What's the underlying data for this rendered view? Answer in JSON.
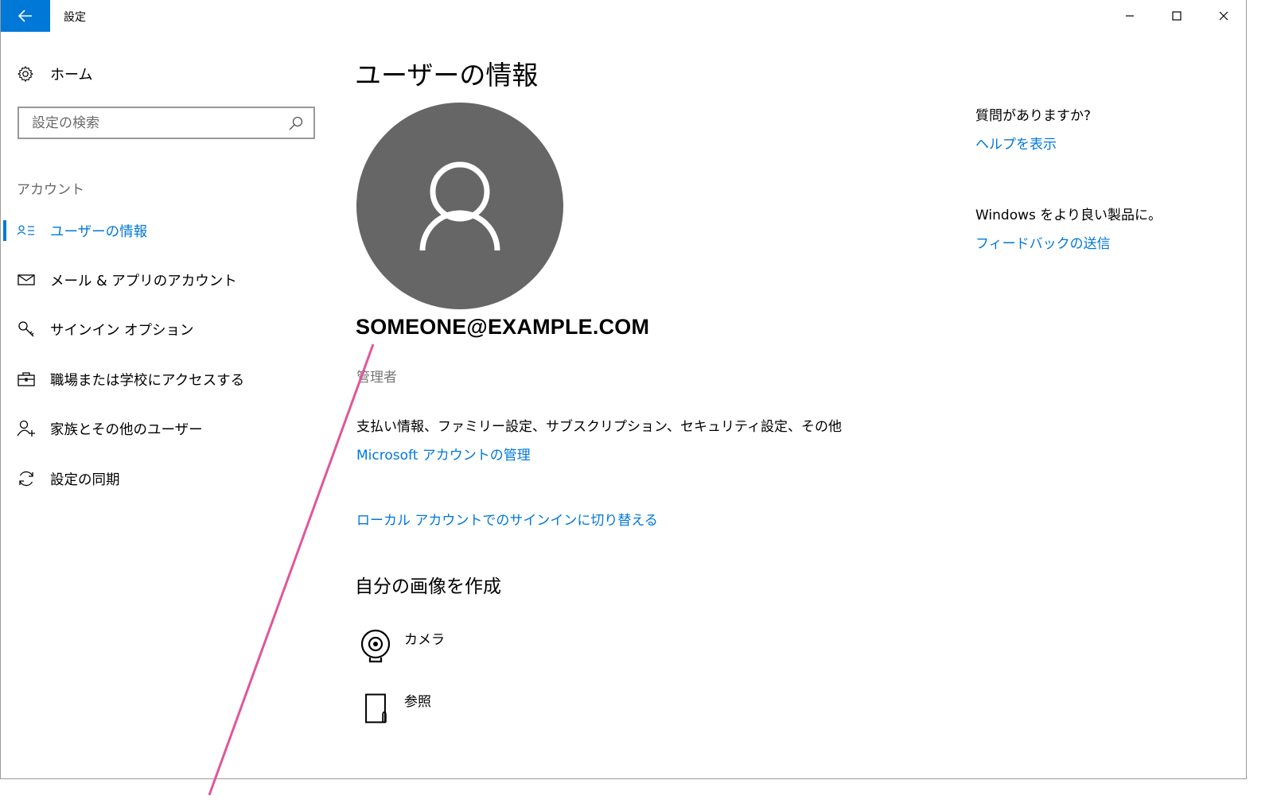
{
  "window": {
    "title": "設定",
    "controls": [
      "minimize-icon",
      "maximize-icon",
      "close-icon"
    ]
  },
  "sidebar": {
    "home_label": "ホーム",
    "search_placeholder": "設定の検索",
    "section_header": "アカウント",
    "items": [
      {
        "label": "ユーザーの情報",
        "icon": "user-info-icon",
        "active": true
      },
      {
        "label": "メール & アプリのアカウント",
        "icon": "mail-icon",
        "active": false
      },
      {
        "label": "サインイン オプション",
        "icon": "key-icon",
        "active": false
      },
      {
        "label": "職場または学校にアクセスする",
        "icon": "briefcase-icon",
        "active": false
      },
      {
        "label": "家族とその他のユーザー",
        "icon": "add-user-icon",
        "active": false
      },
      {
        "label": "設定の同期",
        "icon": "sync-icon",
        "active": false
      }
    ]
  },
  "main": {
    "title": "ユーザーの情報",
    "email": "SOMEONE@EXAMPLE.COM",
    "role": "管理者",
    "billing_text": "支払い情報、ファミリー設定、サブスクリプション、セキュリティ設定、その他",
    "ms_account_link": "Microsoft アカウントの管理",
    "local_signin_link": "ローカル アカウントでのサインインに切り替える",
    "create_picture_title": "自分の画像を作成",
    "picture_options": [
      {
        "label": "カメラ",
        "icon": "webcam-icon"
      },
      {
        "label": "参照",
        "icon": "browse-file-icon"
      }
    ]
  },
  "right_rail": {
    "help_question": "質問がありますか?",
    "help_link": "ヘルプを表示",
    "feedback_prompt": "Windows をより良い製品に。",
    "feedback_link": "フィードバックの送信"
  },
  "colors": {
    "accent": "#0078d7",
    "avatar_bg": "#666666",
    "annotation_line": "#e0569b"
  }
}
